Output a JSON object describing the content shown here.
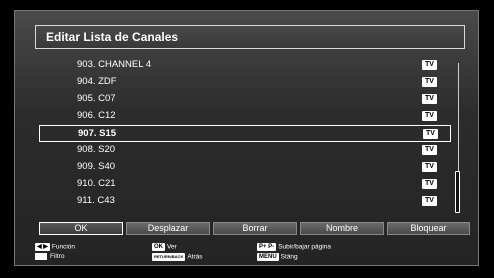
{
  "dialog": {
    "title": "Editar Lista de Canales"
  },
  "channels": [
    {
      "label": "903. CHANNEL 4",
      "badge": "TV"
    },
    {
      "label": "904. ZDF",
      "badge": "TV"
    },
    {
      "label": "905. C07",
      "badge": "TV"
    },
    {
      "label": "906. C12",
      "badge": "TV"
    },
    {
      "label": "907. S15",
      "badge": "TV"
    },
    {
      "label": "908. S20",
      "badge": "TV"
    },
    {
      "label": "909. S40",
      "badge": "TV"
    },
    {
      "label": "910. C21",
      "badge": "TV"
    },
    {
      "label": "911. C43",
      "badge": "TV"
    }
  ],
  "selected_channel": "907. S15",
  "buttons": {
    "ok": "OK",
    "move": "Desplazar",
    "delete": "Borrar",
    "name": "Nombre",
    "lock": "Bloquear"
  },
  "help": {
    "function_label": "Función",
    "filter_label": "Filtro",
    "ok_key": "OK",
    "ok_label": "Ver",
    "return_key": "RETURN/BACK",
    "return_label": "Atrás",
    "page_keys": "P+ P-",
    "page_label": "Subir/bajar página",
    "menu_key": "MENU",
    "menu_label": "Stäng"
  }
}
